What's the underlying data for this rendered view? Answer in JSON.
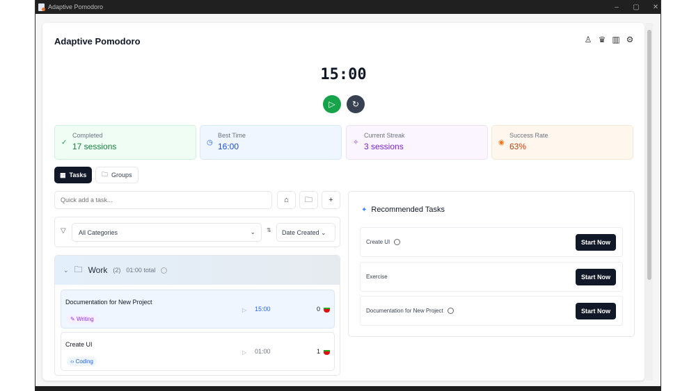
{
  "window": {
    "title": "Adaptive Pomodoro"
  },
  "header": {
    "title": "Adaptive Pomodoro",
    "icons": [
      "user-icon",
      "crown-icon",
      "chart-icon",
      "settings-icon"
    ]
  },
  "timer": {
    "time": "15:00",
    "play_color": "#16a34a",
    "reset_color": "#374151"
  },
  "stats": [
    {
      "label": "Completed",
      "value": "17 sessions",
      "icon": "check-icon",
      "color": "#15803d"
    },
    {
      "label": "Best Time",
      "value": "16:00",
      "icon": "clock-icon",
      "color": "#1d4ed8"
    },
    {
      "label": "Current Streak",
      "value": "3 sessions",
      "icon": "sparkle-icon",
      "color": "#7e22ce"
    },
    {
      "label": "Success Rate",
      "value": "63%",
      "icon": "target-icon",
      "color": "#c2410c"
    }
  ],
  "tabs": [
    {
      "label": "Tasks",
      "active": true
    },
    {
      "label": "Groups",
      "active": false
    }
  ],
  "quick_add": {
    "placeholder": "Quick add a task...",
    "value": ""
  },
  "filters": {
    "category": "All Categories",
    "sort": "Date Created"
  },
  "group": {
    "name": "Work",
    "count": "(2)",
    "total": "01:00 total",
    "tasks": [
      {
        "name": "Documentation for New Project",
        "tag": "Writing",
        "time": "15:00",
        "count": "0"
      },
      {
        "name": "Create UI",
        "tag": "Coding",
        "time": "01:00",
        "count": "1"
      }
    ]
  },
  "recommended": {
    "title": "Recommended Tasks",
    "button": "Start Now",
    "items": [
      {
        "name": "Create UI",
        "info": true
      },
      {
        "name": "Exercise",
        "info": false
      },
      {
        "name": "Documentation for New Project",
        "info": true
      }
    ]
  }
}
